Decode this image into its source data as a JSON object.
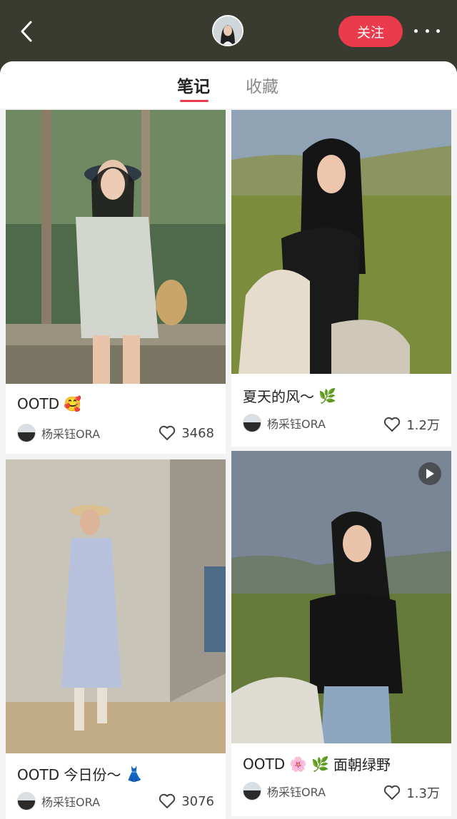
{
  "header": {
    "back_icon": "chevron-left-icon",
    "follow_label": "关注",
    "more_icon": "more-dots-icon"
  },
  "tabs": [
    {
      "label": "笔记",
      "active": true
    },
    {
      "label": "收藏",
      "active": false
    }
  ],
  "accent_color": "#ea3b4d",
  "cards": [
    {
      "title": "OOTD",
      "emojis": [
        "🥰"
      ],
      "author": "杨采钰ORA",
      "likes": "3468",
      "video": false
    },
    {
      "title": "夏天的风～",
      "emojis": [
        "🌿"
      ],
      "author": "杨采钰ORA",
      "likes": "1.2万",
      "video": false
    },
    {
      "title": "OOTD 今日份～",
      "emojis": [
        "👗"
      ],
      "author": "杨采钰ORA",
      "likes": "3076",
      "video": false
    },
    {
      "title": "OOTD",
      "emojis": [
        "🌸",
        "🌿"
      ],
      "title_suffix": "面朝绿野",
      "author": "杨采钰ORA",
      "likes": "1.3万",
      "video": true
    }
  ]
}
